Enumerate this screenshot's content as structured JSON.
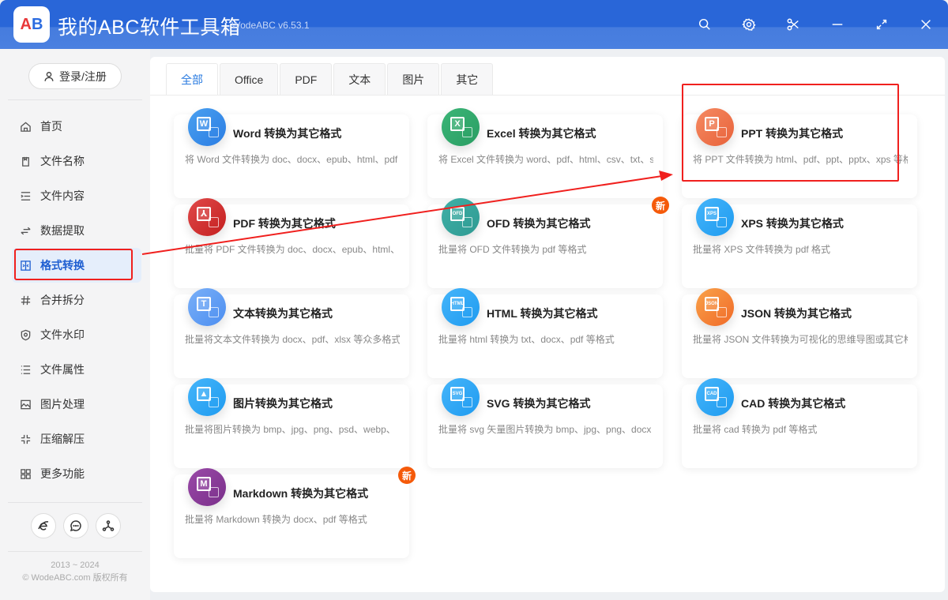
{
  "window": {
    "logo_letters": [
      "A",
      "B"
    ],
    "title": "我的ABC软件工具箱",
    "version": "WodeABC v6.53.1",
    "controls": [
      {
        "name": "search-icon",
        "label": "搜索"
      },
      {
        "name": "gear-icon",
        "label": "设置"
      },
      {
        "name": "scissors-icon",
        "label": "截图"
      },
      {
        "name": "minimize-icon",
        "label": "最小化"
      },
      {
        "name": "maximize-icon",
        "label": "最大化"
      },
      {
        "name": "close-icon",
        "label": "关闭"
      }
    ]
  },
  "sidebar": {
    "login_label": "登录/注册",
    "items": [
      {
        "label": "首页",
        "icon": "home-icon",
        "active": false
      },
      {
        "label": "文件名称",
        "icon": "file-name-icon",
        "active": false
      },
      {
        "label": "文件内容",
        "icon": "file-content-icon",
        "active": false
      },
      {
        "label": "数据提取",
        "icon": "data-extract-icon",
        "active": false
      },
      {
        "label": "格式转换",
        "icon": "format-convert-icon",
        "active": true
      },
      {
        "label": "合并拆分",
        "icon": "merge-split-icon",
        "active": false
      },
      {
        "label": "文件水印",
        "icon": "watermark-icon",
        "active": false
      },
      {
        "label": "文件属性",
        "icon": "file-attributes-icon",
        "active": false
      },
      {
        "label": "图片处理",
        "icon": "image-icon",
        "active": false
      },
      {
        "label": "压缩解压",
        "icon": "compress-icon",
        "active": false
      },
      {
        "label": "更多功能",
        "icon": "more-icon",
        "active": false
      }
    ],
    "footer_buttons": [
      "browser-icon",
      "chat-icon",
      "share-icon"
    ],
    "copyright_years": "2013 ~ 2024",
    "copyright_text": "© WodeABC.com 版权所有"
  },
  "tabs": [
    {
      "label": "全部",
      "active": true
    },
    {
      "label": "Office",
      "active": false
    },
    {
      "label": "PDF",
      "active": false
    },
    {
      "label": "文本",
      "active": false
    },
    {
      "label": "图片",
      "active": false
    },
    {
      "label": "其它",
      "active": false
    }
  ],
  "cards": [
    {
      "title": "Word 转换为其它格式",
      "desc": "将 Word 文件转换为 doc、docx、epub、html、pdf",
      "icon_text": "W",
      "color": "#2b7de3",
      "color2": "#4aa0f0",
      "badge": ""
    },
    {
      "title": "Excel 转换为其它格式",
      "desc": "将 Excel 文件转换为 word、pdf、html、csv、txt、svg",
      "icon_text": "X",
      "color": "#2a9d63",
      "color2": "#3bb577",
      "badge": ""
    },
    {
      "title": "PPT 转换为其它格式",
      "desc": "将 PPT 文件转换为 html、pdf、ppt、pptx、xps 等格式",
      "icon_text": "P",
      "color": "#e8623a",
      "color2": "#f58a62",
      "badge": ""
    },
    {
      "title": "PDF 转换为其它格式",
      "desc": "批量将 PDF 文件转换为 doc、docx、epub、html、",
      "icon_text": "⅄",
      "color": "#c41f1f",
      "color2": "#e04a4a",
      "badge": ""
    },
    {
      "title": "OFD 转换为其它格式",
      "desc": "批量将 OFD 文件转换为 pdf 等格式",
      "icon_text": "OFD",
      "color": "#2f9a92",
      "color2": "#3fb0a7",
      "badge": "新"
    },
    {
      "title": "XPS 转换为其它格式",
      "desc": "批量将 XPS 文件转换为 pdf 格式",
      "icon_text": "XPS",
      "color": "#1f9bf0",
      "color2": "#45b5fa",
      "badge": ""
    },
    {
      "title": "文本转换为其它格式",
      "desc": "批量将文本文件转换为 docx、pdf、xlsx 等众多格式",
      "icon_text": "T",
      "color": "#4c8ef0",
      "color2": "#7ab0f8",
      "badge": ""
    },
    {
      "title": "HTML 转换为其它格式",
      "desc": "批量将 html 转换为 txt、docx、pdf 等格式",
      "icon_text": "HTML",
      "color": "#1f9bf0",
      "color2": "#45b5fa",
      "badge": ""
    },
    {
      "title": "JSON 转换为其它格式",
      "desc": "批量将 JSON 文件转换为可视化的思维导图或其它格式",
      "icon_text": "JSON",
      "color": "#f06a28",
      "color2": "#f9a24a",
      "badge": ""
    },
    {
      "title": "图片转换为其它格式",
      "desc": "批量将图片转换为 bmp、jpg、png、psd、webp、",
      "icon_text": "▲",
      "color": "#1f9bf0",
      "color2": "#45b5fa",
      "badge": ""
    },
    {
      "title": "SVG 转换为其它格式",
      "desc": "批量将 svg 矢量图片转换为 bmp、jpg、png、docx",
      "icon_text": "SVG",
      "color": "#1f9bf0",
      "color2": "#45b5fa",
      "badge": ""
    },
    {
      "title": "CAD 转换为其它格式",
      "desc": "批量将 cad 转换为 pdf 等格式",
      "icon_text": "CAD",
      "color": "#1f9bf0",
      "color2": "#45b5fa",
      "badge": ""
    },
    {
      "title": "Markdown 转换为其它格式",
      "desc": "批量将 Markdown 转换为 docx、pdf 等格式",
      "icon_text": "M",
      "color": "#7a2f8a",
      "color2": "#9a4aa8",
      "badge": "新"
    }
  ],
  "annotations": {
    "highlight_color": "#f0201e",
    "highlighted_card": "PPT 转换为其它格式",
    "highlighted_nav": "格式转换"
  }
}
